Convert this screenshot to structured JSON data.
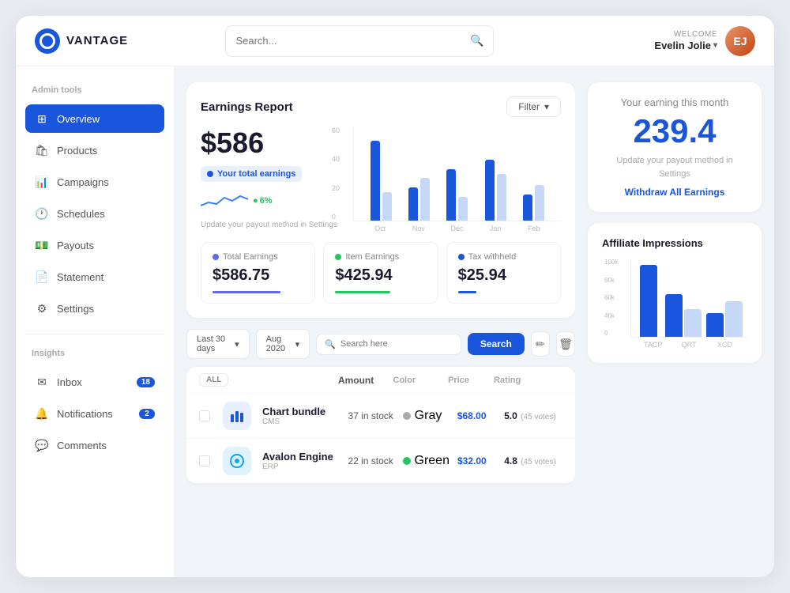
{
  "app": {
    "logo_text": "VANTAGE",
    "search_placeholder": "Search...",
    "welcome_label": "WELCOME",
    "user_name": "Evelin Jolie",
    "avatar_initials": "EJ"
  },
  "sidebar": {
    "admin_section_label": "Admin tools",
    "items": [
      {
        "id": "overview",
        "label": "Overview",
        "active": true,
        "icon": "grid"
      },
      {
        "id": "products",
        "label": "Products",
        "active": false,
        "icon": "bag"
      },
      {
        "id": "campaigns",
        "label": "Campaigns",
        "active": false,
        "icon": "bar-chart"
      },
      {
        "id": "schedules",
        "label": "Schedules",
        "active": false,
        "icon": "clock"
      },
      {
        "id": "payouts",
        "label": "Payouts",
        "active": false,
        "icon": "dollar"
      },
      {
        "id": "statement",
        "label": "Statement",
        "active": false,
        "icon": "file"
      },
      {
        "id": "settings",
        "label": "Settings",
        "active": false,
        "icon": "gear"
      }
    ],
    "insights_section_label": "Insights",
    "insight_items": [
      {
        "id": "inbox",
        "label": "Inbox",
        "badge": 18,
        "icon": "mail"
      },
      {
        "id": "notifications",
        "label": "Notifications",
        "badge": 2,
        "icon": "bell"
      },
      {
        "id": "comments",
        "label": "Comments",
        "badge": null,
        "icon": "chat"
      }
    ]
  },
  "earnings_report": {
    "title": "Earnings Report",
    "filter_label": "Filter",
    "big_amount": "$586",
    "total_badge_label": "Your total earnings",
    "trend_pct": "6%",
    "settings_hint": "Update your payout method in Settings",
    "chart": {
      "y_labels": [
        "60",
        "40",
        "20",
        "0"
      ],
      "x_labels": [
        "Oct",
        "Nov",
        "Dec",
        "Jan",
        "Feb"
      ],
      "bars": [
        {
          "dark": 85,
          "light": 30
        },
        {
          "dark": 35,
          "light": 45
        },
        {
          "dark": 55,
          "light": 25
        },
        {
          "dark": 65,
          "light": 50
        },
        {
          "dark": 28,
          "light": 38
        }
      ]
    },
    "stats": [
      {
        "label": "Total Earnings",
        "value": "$586.75",
        "color": "#6366f1",
        "bar_pct": 75
      },
      {
        "label": "Item Earnings",
        "value": "$425.94",
        "color": "#22c55e",
        "bar_pct": 60
      },
      {
        "label": "Tax withheld",
        "value": "$25.94",
        "color": "#1a56db",
        "bar_pct": 20
      }
    ]
  },
  "table_section": {
    "filter1_label": "Last 30 days",
    "filter2_label": "Aug 2020",
    "search_placeholder": "Search here",
    "search_btn": "Search",
    "tab_all": "ALL",
    "columns": [
      "ALL",
      "Amount",
      "Color",
      "Price",
      "Rating"
    ],
    "rows": [
      {
        "icon": "📦",
        "icon_bg": "#e8f0fe",
        "icon_color": "#1a56db",
        "name": "Chart bundle",
        "sub": "CMS",
        "amount": "37 in stock",
        "color_name": "Gray",
        "color_hex": "#aaa",
        "price": "$68.00",
        "rating": "5.0",
        "votes": "(45 votes)"
      },
      {
        "icon": "📍",
        "icon_bg": "#e0f2fe",
        "icon_color": "#0ea5e9",
        "name": "Avalon Engine",
        "sub": "ERP",
        "amount": "22 in stock",
        "color_name": "Green",
        "color_hex": "#22c55e",
        "price": "$32.00",
        "rating": "4.8",
        "votes": "(45 votes)"
      }
    ]
  },
  "earning_this_month": {
    "title": "Your earning this month",
    "amount": "239.4",
    "hint": "Update your payout method in Settings",
    "withdraw_label": "Withdraw All Earnings"
  },
  "affiliate_impressions": {
    "title": "Affiliate Impressions",
    "y_labels": [
      "100k",
      "80k",
      "60k",
      "40k",
      "0"
    ],
    "x_labels": [
      "TACP",
      "QRT",
      "XCD"
    ],
    "bars": [
      {
        "dark": 92,
        "light": 0
      },
      {
        "dark": 55,
        "light": 35
      },
      {
        "dark": 30,
        "light": 45
      }
    ]
  }
}
